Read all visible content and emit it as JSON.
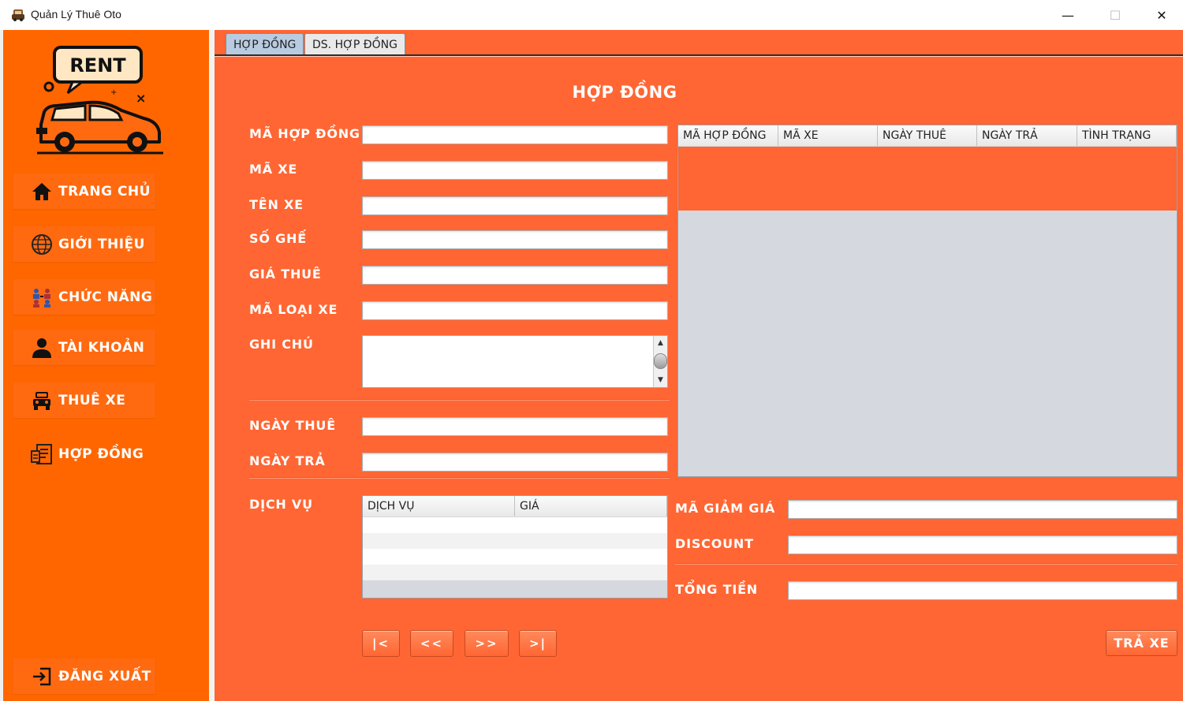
{
  "window": {
    "title": "Quản Lý Thuê Oto",
    "minimize": "—",
    "maximize": "☐",
    "close": "✕"
  },
  "logo": {
    "text": "RENT",
    "icon": "rent-car-logo"
  },
  "sidebar": {
    "items": [
      {
        "label": "TRANG CHỦ",
        "icon": "home-icon"
      },
      {
        "label": "GIỚI THIỆU",
        "icon": "globe-icon"
      },
      {
        "label": "CHỨC NĂNG",
        "icon": "features-icon"
      },
      {
        "label": "TÀI KHOẢN",
        "icon": "user-icon"
      },
      {
        "label": "THUÊ XE",
        "icon": "car-icon"
      },
      {
        "label": "HỢP ĐỒNG",
        "icon": "contract-icon"
      },
      {
        "label": "ĐĂNG XUẤT",
        "icon": "logout-icon"
      }
    ]
  },
  "tabs": [
    {
      "label": "HỢP ĐỒNG",
      "active": true
    },
    {
      "label": "DS. HỢP ĐỒNG",
      "active": false
    }
  ],
  "form": {
    "title": "HỢP ĐỒNG",
    "labels": {
      "ma_hop_dong": "MÃ HỢP ĐỒNG",
      "ma_xe": "MÃ XE",
      "ten_xe": "TÊN XE",
      "so_ghe": "SỐ GHẾ",
      "gia_thue": "GIÁ THUÊ",
      "ma_loai_xe": "MÃ LOẠI XE",
      "ghi_chu": "GHI CHÚ",
      "ngay_thue": "NGÀY THUÊ",
      "ngay_tra": "NGÀY TRẢ",
      "dich_vu": "DỊCH VỤ",
      "ma_giam_gia": "MÃ GIẢM GIÁ",
      "discount": "DISCOUNT",
      "tong_tien": "TỔNG TIỀN"
    },
    "values": {
      "ma_hop_dong": "",
      "ma_xe": "",
      "ten_xe": "",
      "so_ghe": "",
      "gia_thue": "",
      "ma_loai_xe": "",
      "ghi_chu": "",
      "ngay_thue": "",
      "ngay_tra": "",
      "ma_giam_gia": "",
      "discount": "",
      "tong_tien": ""
    }
  },
  "contract_table": {
    "columns": [
      "MÃ HỢP ĐỒNG",
      "MÃ XE",
      "NGÀY THUÊ",
      "NGÀY TRẢ",
      "TÌNH TRẠNG"
    ],
    "rows": []
  },
  "service_table": {
    "columns": [
      "DỊCH VỤ",
      "GIÁ"
    ],
    "rows": []
  },
  "nav_buttons": {
    "first": "|<",
    "prev": "<<",
    "next": ">>",
    "last": ">|"
  },
  "return_button": "TRẢ XE",
  "colors": {
    "sidebar": "#ff6600",
    "main": "#ff6633",
    "accent_text": "#ffffff"
  }
}
